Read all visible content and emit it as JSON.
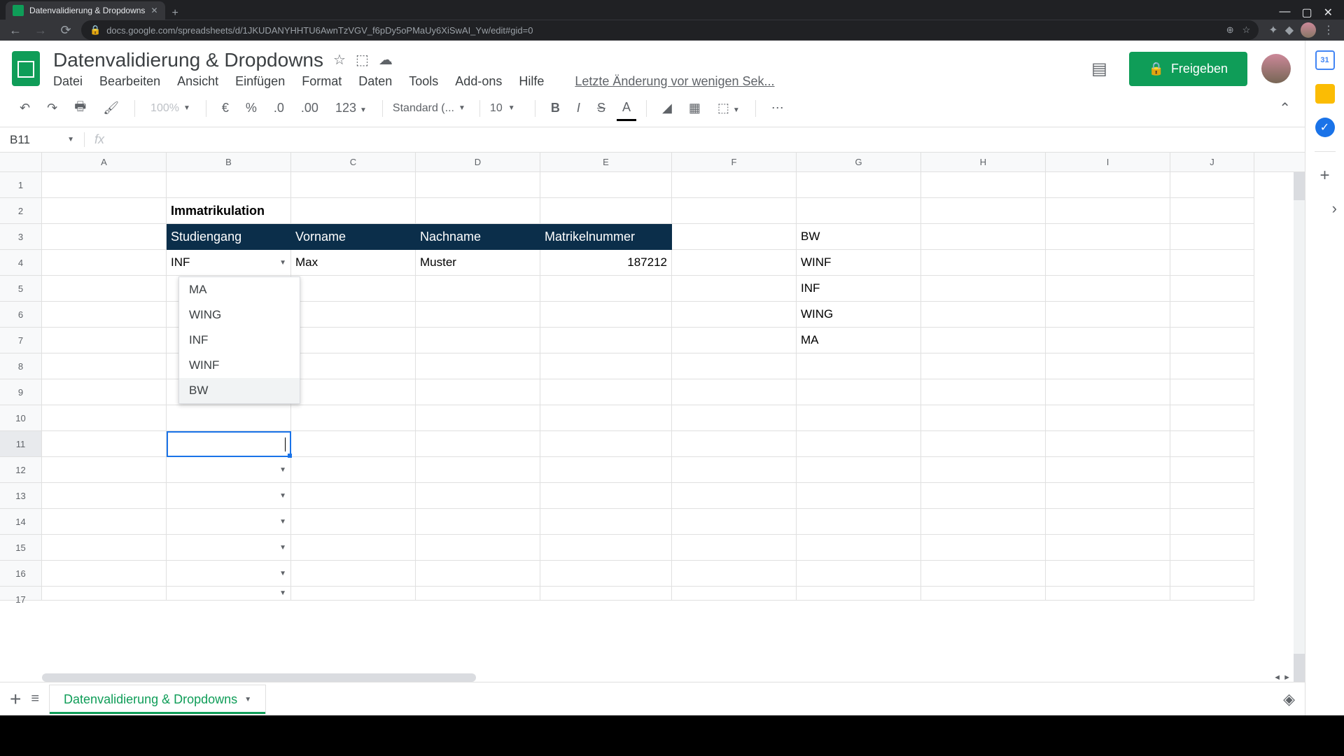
{
  "browser": {
    "tab_title": "Datenvalidierung & Dropdowns",
    "url": "docs.google.com/spreadsheets/d/1JKUDANYHHTU6AwnTzVGV_f6pDy5oPMaUy6XiSwAI_Yw/edit#gid=0"
  },
  "doc": {
    "title": "Datenvalidierung & Dropdowns",
    "last_edit": "Letzte Änderung vor wenigen Sek...",
    "share_label": "Freigeben"
  },
  "menus": {
    "file": "Datei",
    "edit": "Bearbeiten",
    "view": "Ansicht",
    "insert": "Einfügen",
    "format": "Format",
    "data": "Daten",
    "tools": "Tools",
    "addons": "Add-ons",
    "help": "Hilfe"
  },
  "toolbar": {
    "zoom": "100%",
    "currency": "€",
    "percent": "%",
    "dec_dec": ".0",
    "inc_dec": ".00",
    "num_fmt": "123",
    "font": "Standard (...",
    "size": "10"
  },
  "formula": {
    "name_box": "B11",
    "fx": "fx"
  },
  "columns": [
    "A",
    "B",
    "C",
    "D",
    "E",
    "F",
    "G",
    "H",
    "I",
    "J"
  ],
  "rows_visible": 17,
  "sheet": {
    "title_cell": "Immatrikulation",
    "headers": {
      "b": "Studiengang",
      "c": "Vorname",
      "d": "Nachname",
      "e": "Matrikelnummer"
    },
    "row4": {
      "b": "INF",
      "c": "Max",
      "d": "Muster",
      "e": "187212"
    },
    "lookup_list": [
      "BW",
      "WINF",
      "INF",
      "WING",
      "MA"
    ]
  },
  "dropdown_options": [
    "MA",
    "WING",
    "INF",
    "WINF",
    "BW"
  ],
  "sheet_tab": "Datenvalidierung & Dropdowns"
}
